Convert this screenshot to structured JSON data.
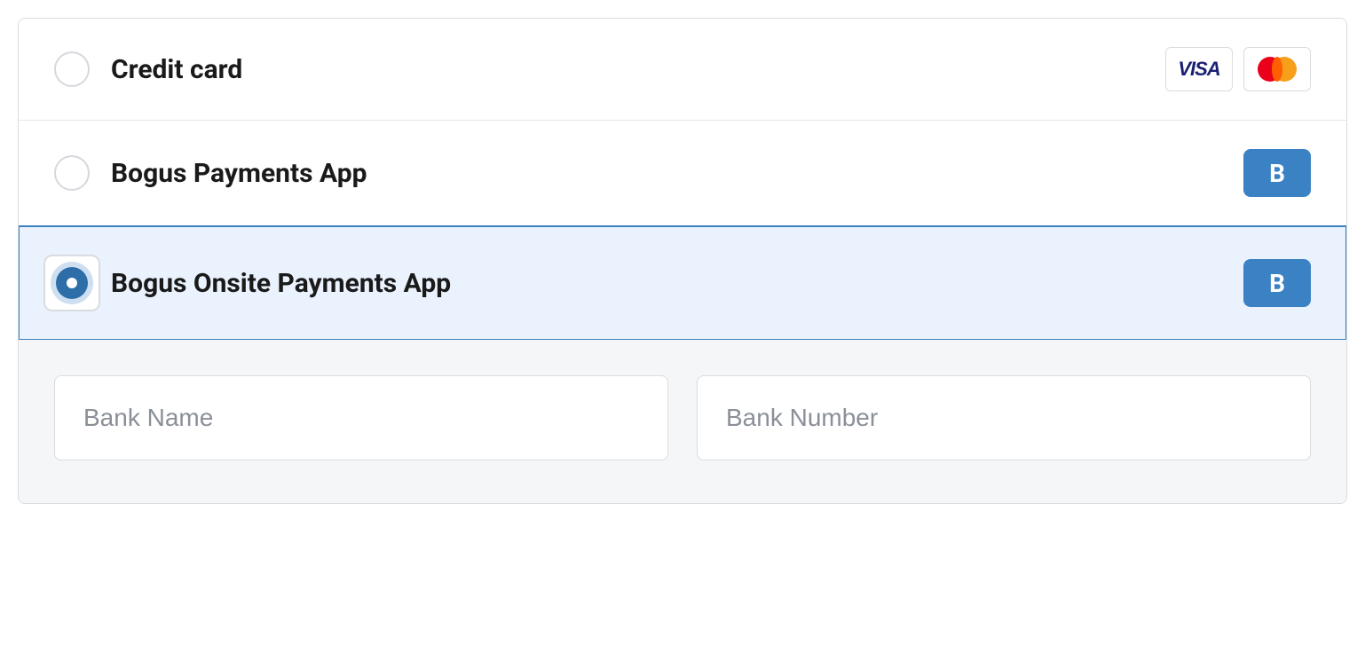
{
  "payment_options": {
    "credit_card": {
      "label": "Credit card",
      "selected": false,
      "badges": {
        "visa": "VISA"
      }
    },
    "bogus_payments": {
      "label": "Bogus Payments App",
      "selected": false,
      "badge_letter": "B"
    },
    "bogus_onsite": {
      "label": "Bogus Onsite Payments App",
      "selected": true,
      "badge_letter": "B"
    }
  },
  "form": {
    "bank_name_placeholder": "Bank Name",
    "bank_number_placeholder": "Bank Number"
  }
}
